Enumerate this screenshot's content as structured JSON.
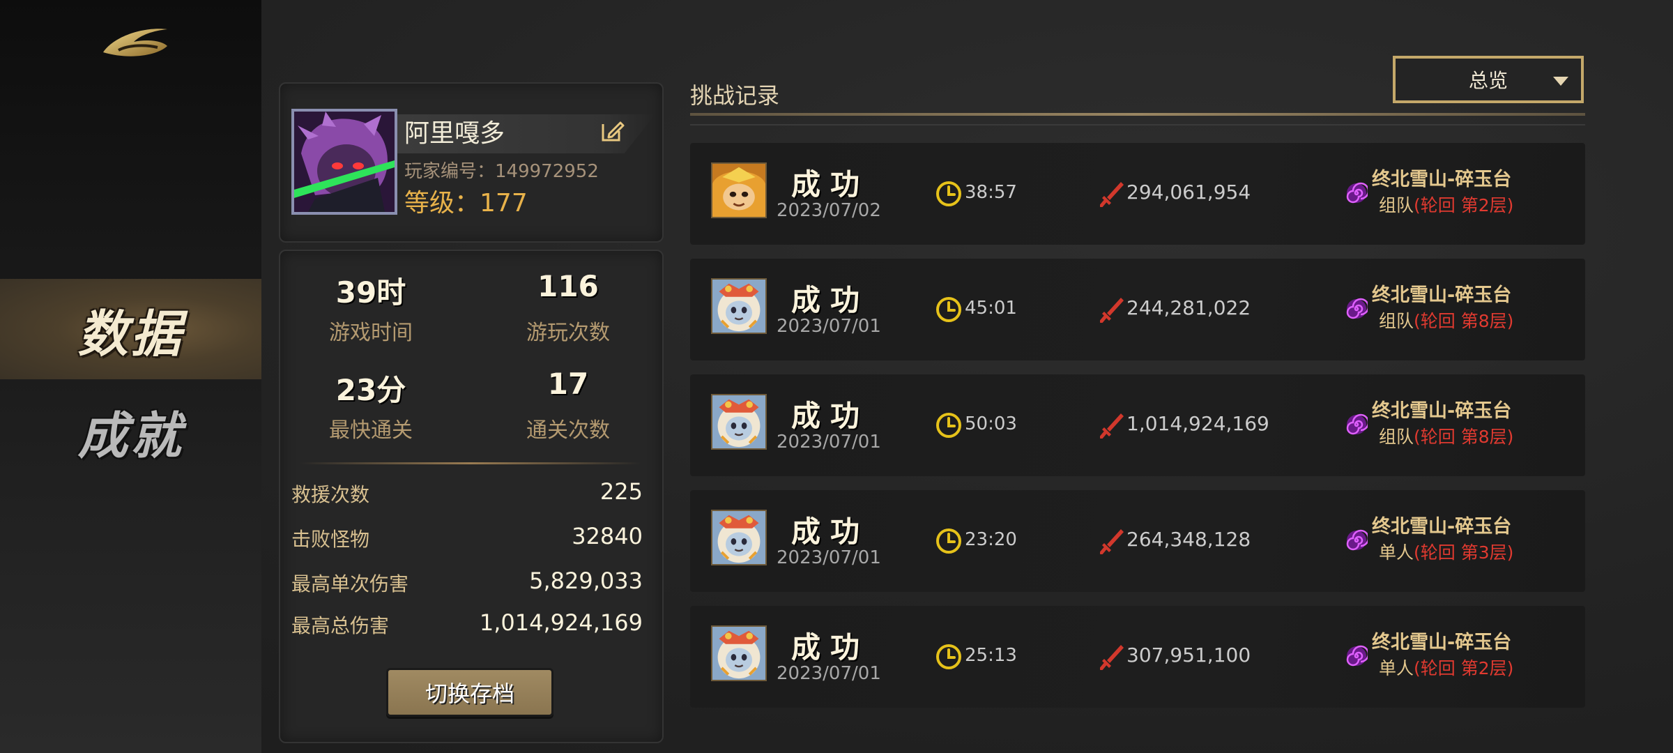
{
  "nav": {
    "items": [
      {
        "label": "数据",
        "active": true
      },
      {
        "label": "成就",
        "active": false
      }
    ]
  },
  "profile": {
    "name": "阿里嘎多",
    "player_id_label": "玩家编号：",
    "player_id": "149972952",
    "level_label": "等级：",
    "level": "177"
  },
  "stats": {
    "play_time": {
      "value": "39时",
      "label": "游戏时间"
    },
    "play_count": {
      "value": "116",
      "label": "游玩次数"
    },
    "fastest_clear": {
      "value": "23分",
      "label": "最快通关"
    },
    "clear_count": {
      "value": "17",
      "label": "通关次数"
    },
    "rows": [
      {
        "label": "救援次数",
        "value": "225"
      },
      {
        "label": "击败怪物",
        "value": "32840"
      },
      {
        "label": "最高单次伤害",
        "value": "5,829,033"
      },
      {
        "label": "最高总伤害",
        "value": "1,014,924,169"
      }
    ],
    "switch_button": "切换存档"
  },
  "records": {
    "title": "挑战记录",
    "filter": "总览",
    "items": [
      {
        "result": "成功",
        "date": "2023/07/02",
        "time": "38:57",
        "damage": "294,061,954",
        "stage": "终北雪山-碎玉台",
        "mode": "组队",
        "cycle": "(轮回  第2层)",
        "portrait": "monkey"
      },
      {
        "result": "成功",
        "date": "2023/07/01",
        "time": "45:01",
        "damage": "244,281,022",
        "stage": "终北雪山-碎玉台",
        "mode": "组队",
        "cycle": "(轮回  第8层)",
        "portrait": "lion"
      },
      {
        "result": "成功",
        "date": "2023/07/01",
        "time": "50:03",
        "damage": "1,014,924,169",
        "stage": "终北雪山-碎玉台",
        "mode": "组队",
        "cycle": "(轮回  第8层)",
        "portrait": "lion"
      },
      {
        "result": "成功",
        "date": "2023/07/01",
        "time": "23:20",
        "damage": "264,348,128",
        "stage": "终北雪山-碎玉台",
        "mode": "单人",
        "cycle": "(轮回  第3层)",
        "portrait": "lion"
      },
      {
        "result": "成功",
        "date": "2023/07/01",
        "time": "25:13",
        "damage": "307,951,100",
        "stage": "终北雪山-碎玉台",
        "mode": "单人",
        "cycle": "(轮回  第2层)",
        "portrait": "lion"
      }
    ]
  },
  "colors": {
    "accent_gold": "#c4a86a",
    "level_orange": "#e8b24a",
    "cycle_red": "#e03a30",
    "spiral_purple": "#b02ad8"
  }
}
